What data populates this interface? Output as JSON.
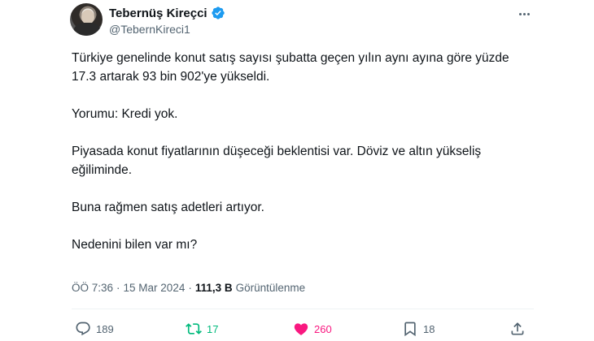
{
  "author": {
    "name": "Tebernüş Kireçci",
    "handle": "@TebernKireci1",
    "verified": true
  },
  "tweet": {
    "paragraphs": [
      "Türkiye genelinde konut satış sayısı şubatta geçen yılın aynı ayına göre yüzde 17.3 artarak 93 bin 902'ye yükseldi.",
      "Yorumu: Kredi yok.",
      "Piyasada konut fiyatlarının düşeceği beklentisi var. Döviz ve altın yükseliş eğiliminde.",
      "Buna rağmen satış adetleri artıyor.",
      "Nedenini bilen var mı?"
    ]
  },
  "meta": {
    "time": "ÖÖ 7:36",
    "separator": "·",
    "date": "15 Mar 2024",
    "views_count": "111,3 B",
    "views_label": "Görüntülenme"
  },
  "actions": {
    "replies": "189",
    "retweets": "17",
    "likes": "260",
    "bookmarks": "18"
  },
  "colors": {
    "verified": "#1d9bf0",
    "retweet": "#00ba7c",
    "like": "#f91880",
    "secondary_text": "#536471"
  },
  "icons": [
    "verified-badge-icon",
    "more-icon",
    "reply-icon",
    "retweet-icon",
    "like-icon",
    "bookmark-icon",
    "share-icon"
  ]
}
